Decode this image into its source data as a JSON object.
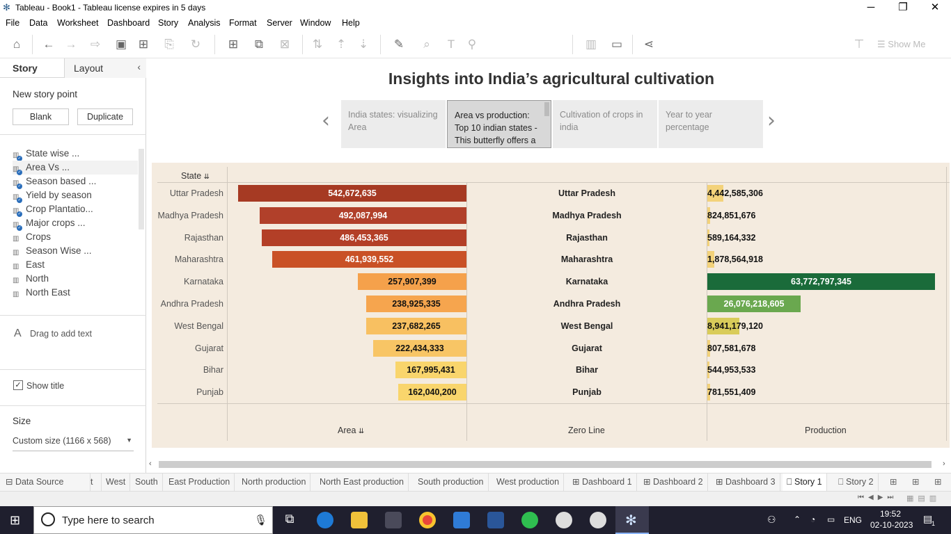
{
  "window": {
    "title": "Tableau - Book1 - Tableau license expires in 5 days",
    "min": "─",
    "max": "❐",
    "close": "✕"
  },
  "menu": [
    "File",
    "Data",
    "Worksheet",
    "Dashboard",
    "Story",
    "Analysis",
    "Format",
    "Server",
    "Window",
    "Help"
  ],
  "toolbar": {
    "show_me": "Show Me"
  },
  "left": {
    "tab_story": "Story",
    "tab_layout": "Layout",
    "collapse": "‹",
    "new_story_point": "New story point",
    "blank": "Blank",
    "duplicate": "Duplicate",
    "sheets": [
      {
        "label": "State wise ...",
        "used": true
      },
      {
        "label": "Area Vs ...",
        "used": true
      },
      {
        "label": "Season based ...",
        "used": true
      },
      {
        "label": "Yield by season",
        "used": true
      },
      {
        "label": "Crop Plantatio...",
        "used": true
      },
      {
        "label": "Major crops ...",
        "used": true
      },
      {
        "label": "Crops",
        "used": false
      },
      {
        "label": "Season Wise ...",
        "used": false
      },
      {
        "label": "East",
        "used": false
      },
      {
        "label": "North",
        "used": false
      },
      {
        "label": "North East",
        "used": false
      }
    ],
    "drag_text_icon": "A",
    "drag_text": "Drag to add text",
    "show_title": "Show title",
    "size_label": "Size",
    "size_value": "Custom size (1166 x 568)"
  },
  "story": {
    "title": "Insights into India’s agricultural cultivation",
    "points": [
      {
        "text": "India states: visualizing Area",
        "active": false
      },
      {
        "text": "Area vs production: Top 10 indian states - This butterfly offers a",
        "active": true
      },
      {
        "text": "Cultivation of crops in india",
        "active": false
      },
      {
        "text": "Year to year percentage",
        "active": false
      }
    ],
    "prev": "‹",
    "next": "›"
  },
  "chart_data": {
    "type": "bar",
    "subtype": "butterfly",
    "categories": [
      "Uttar Pradesh",
      "Madhya Pradesh",
      "Rajasthan",
      "Maharashtra",
      "Karnataka",
      "Andhra Pradesh",
      "West Bengal",
      "Gujarat",
      "Bihar",
      "Punjab"
    ],
    "row_header": "State",
    "series": [
      {
        "name": "Area",
        "values": [
          542672635,
          492087994,
          486453365,
          461939552,
          257907399,
          238925335,
          237682265,
          222434333,
          167995431,
          162040200
        ],
        "labels": [
          "542,672,635",
          "492,087,994",
          "486,453,365",
          "461,939,552",
          "257,907,399",
          "238,925,335",
          "237,682,265",
          "222,434,333",
          "167,995,431",
          "162,040,200"
        ],
        "colors": [
          "#a63a23",
          "#b1402a",
          "#b33f27",
          "#c95126",
          "#f5a14b",
          "#f6a54e",
          "#f8c061",
          "#f8c565",
          "#f9d56c",
          "#f9d56c"
        ]
      },
      {
        "name": "Production",
        "values": [
          4442585306,
          824851676,
          589164332,
          1878564918,
          63772797345,
          26076218605,
          8941179120,
          807581678,
          544953533,
          781551409
        ],
        "labels": [
          "4,442,585,306",
          "824,851,676",
          "589,164,332",
          "1,878,564,918",
          "63,772,797,345",
          "26,076,218,605",
          "8,941,179,120",
          "807,581,678",
          "544,953,533",
          "781,551,409"
        ],
        "colors": [
          "#f3d27a",
          "#f3d27a",
          "#f3d27a",
          "#f3d27a",
          "#1a6b3a",
          "#6aa84f",
          "#d9cc5a",
          "#f3d27a",
          "#f3d27a",
          "#f3d27a"
        ]
      }
    ],
    "middle_column": "Zero Line",
    "footer": {
      "area": "Area",
      "zero": "Zero Line",
      "production": "Production"
    },
    "sort_icon": "⇊"
  },
  "sheet_tabs": [
    "Data Source",
    "t",
    "West",
    "South",
    "East Production",
    "North production",
    "North East production",
    "South production",
    "West production",
    "Dashboard 1",
    "Dashboard 2",
    "Dashboard 3",
    "Story 1",
    "Story 2"
  ],
  "active_tab": "Story 1",
  "taskbar": {
    "search_placeholder": "Type here to search",
    "lang": "ENG",
    "time": "19:52",
    "date": "02-10-2023",
    "notifications": "1"
  }
}
